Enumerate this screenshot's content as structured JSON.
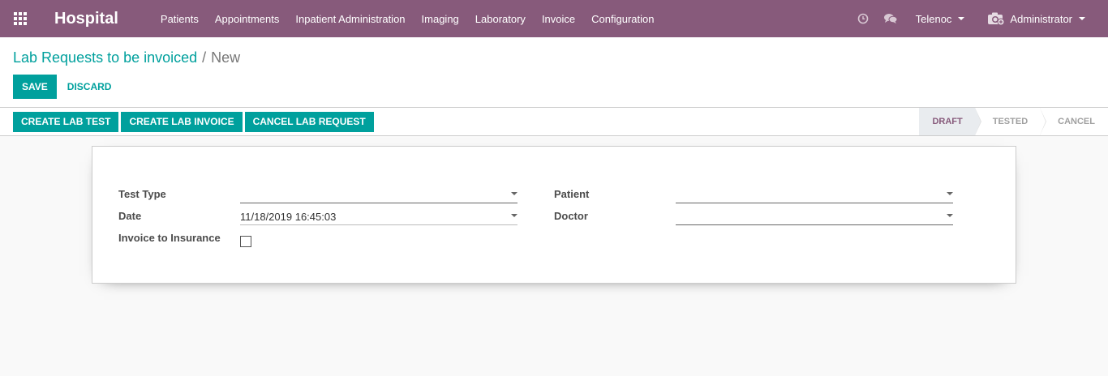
{
  "navbar": {
    "brand": "Hospital",
    "menu": [
      {
        "label": "Patients"
      },
      {
        "label": "Appointments"
      },
      {
        "label": "Inpatient Administration"
      },
      {
        "label": "Imaging"
      },
      {
        "label": "Laboratory"
      },
      {
        "label": "Invoice"
      },
      {
        "label": "Configuration"
      }
    ],
    "company": "Telenoc",
    "user": "Administrator",
    "colors": {
      "bar": "#875a7b",
      "accent": "#00a09d"
    }
  },
  "breadcrumb": {
    "parent": "Lab Requests to be invoiced",
    "separator": "/",
    "current": "New"
  },
  "control_buttons": {
    "save": "SAVE",
    "discard": "DISCARD"
  },
  "header_buttons": [
    {
      "label": "CREATE LAB TEST"
    },
    {
      "label": "CREATE LAB INVOICE"
    },
    {
      "label": "CANCEL LAB REQUEST"
    }
  ],
  "stages": [
    {
      "label": "DRAFT",
      "active": true
    },
    {
      "label": "TESTED",
      "active": false
    },
    {
      "label": "CANCEL",
      "active": false
    }
  ],
  "form": {
    "test_type": {
      "label": "Test Type",
      "value": ""
    },
    "date": {
      "label": "Date",
      "value": "11/18/2019 16:45:03"
    },
    "invoice_to_insurance": {
      "label": "Invoice to Insurance",
      "checked": false
    },
    "patient": {
      "label": "Patient",
      "value": ""
    },
    "doctor": {
      "label": "Doctor",
      "value": ""
    }
  }
}
